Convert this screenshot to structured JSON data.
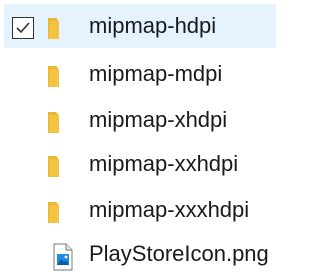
{
  "items": [
    {
      "label": "mipmap-hdpi",
      "icon": "folder-icon",
      "selected": true,
      "checked": true
    },
    {
      "label": "mipmap-mdpi",
      "icon": "folder-icon",
      "selected": false,
      "checked": false
    },
    {
      "label": "mipmap-xhdpi",
      "icon": "folder-icon",
      "selected": false,
      "checked": false
    },
    {
      "label": "mipmap-xxhdpi",
      "icon": "folder-icon",
      "selected": false,
      "checked": false
    },
    {
      "label": "mipmap-xxxhdpi",
      "icon": "folder-icon",
      "selected": false,
      "checked": false
    },
    {
      "label": "PlayStoreIcon.png",
      "icon": "image-file-icon",
      "selected": false,
      "checked": false
    }
  ],
  "colors": {
    "selection_background": "#e5f3ff",
    "folder": "#f5c342",
    "text": "#1a1a1a"
  }
}
